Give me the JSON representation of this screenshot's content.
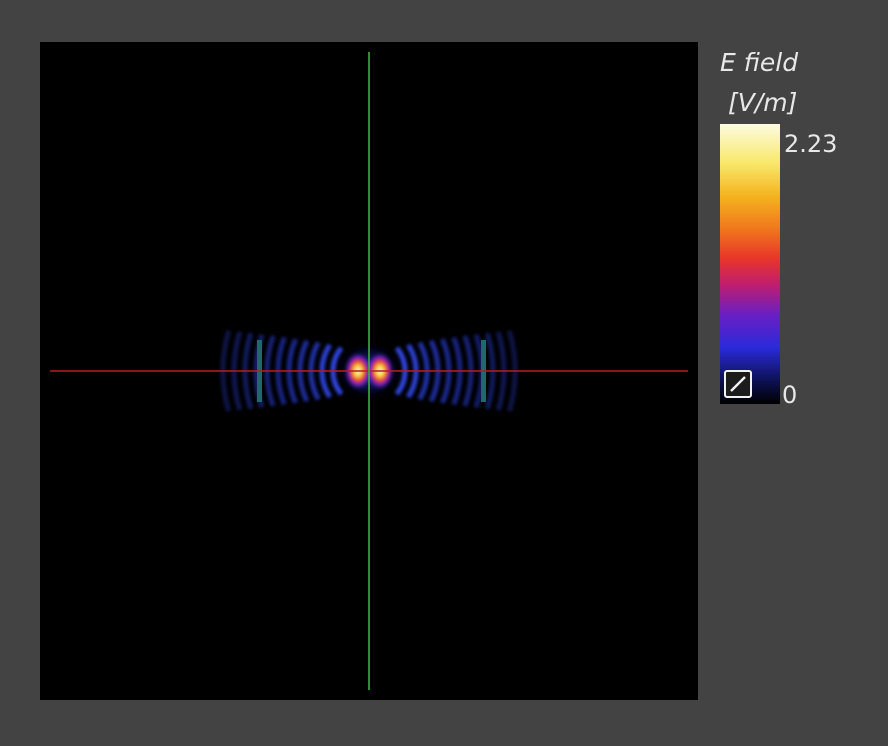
{
  "colorbar": {
    "title_line1": "E field",
    "title_line2": "[V/m]",
    "max_label": "2.23",
    "min_label": "0",
    "toggle_icon": "diagonal-scale-toggle-icon"
  },
  "colors": {
    "background": "#434343",
    "viewport_bg": "#000000",
    "axis_horizontal": "#b21f24",
    "axis_vertical": "#3bb33c",
    "colormap": [
      "#000000",
      "#0c1050",
      "#2a2ad8",
      "#6a1fc4",
      "#c21e6a",
      "#e8362a",
      "#f07a1c",
      "#f4b21e",
      "#f8e86a",
      "#fdfbe0"
    ]
  }
}
